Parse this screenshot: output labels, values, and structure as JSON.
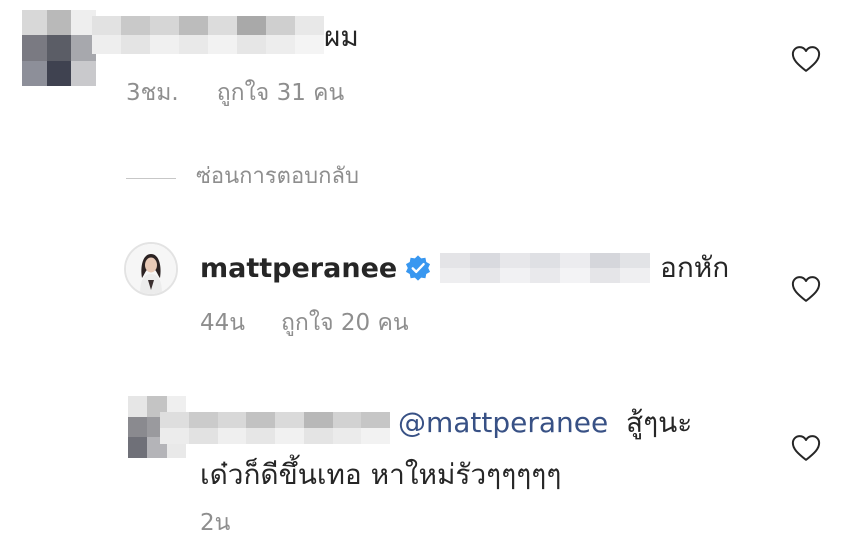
{
  "comments": [
    {
      "text_tail": "ผม",
      "time": "3ชม.",
      "likes": "ถูกใจ 31 คน"
    }
  ],
  "hide_replies_label": "ซ่อนการตอบกลับ",
  "replies": [
    {
      "username": "mattperanee",
      "verified": true,
      "text_tail": "อกหัก",
      "time": "44น",
      "likes": "ถูกใจ 20 คน"
    },
    {
      "mention": "@mattperanee",
      "text_line1": "สู้ๆนะ",
      "text_line2": "เด๋วก็ดีขึ้นเทอ หาใหม่รัวๆๆๆๆๆ",
      "time": "2น"
    }
  ],
  "icons": {
    "like": "heart-outline-icon",
    "verified": "verified-badge-icon"
  },
  "colors": {
    "text": "#262626",
    "secondary": "#8e8e8e",
    "mention": "#385185",
    "verified": "#3897f0"
  }
}
